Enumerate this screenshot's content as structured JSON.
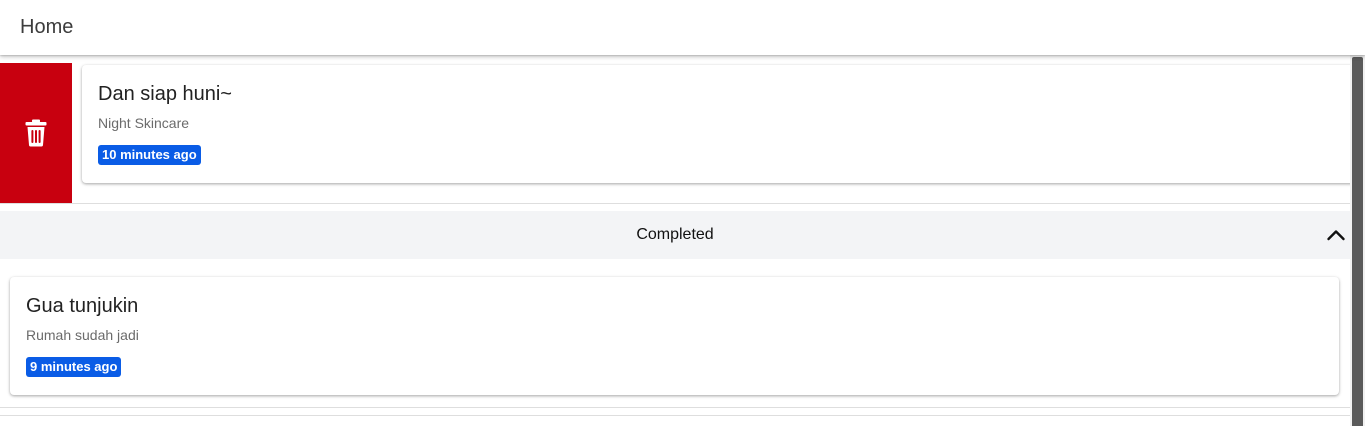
{
  "header": {
    "title": "Home"
  },
  "colors": {
    "delete_bg": "#c8000f",
    "badge_bg": "#0a5ce6",
    "section_bg": "#f3f4f6"
  },
  "pending": {
    "items": [
      {
        "title": "Dan siap huni~",
        "subtitle": "Night Skincare",
        "time": "10 minutes ago",
        "swipe_action_icon": "trash-icon"
      }
    ]
  },
  "completed": {
    "label": "Completed",
    "toggle_icon": "chevron-up-icon",
    "items": [
      {
        "title": "Gua tunjukin",
        "subtitle": "Rumah sudah jadi",
        "time": "9 minutes ago"
      }
    ]
  }
}
